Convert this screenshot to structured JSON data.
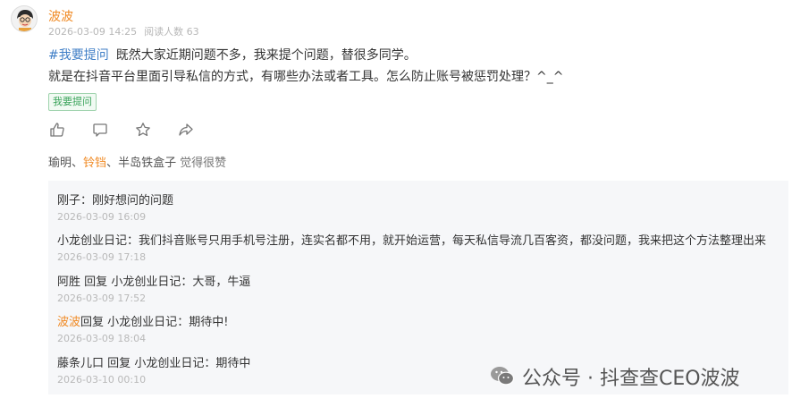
{
  "post": {
    "author": "波波",
    "date": "2026-03-09 14:25",
    "reads": "阅读人数 63",
    "hashtag": "#我要提问",
    "line1": "既然大家近期问题不多，我来提个问题，替很多同学。",
    "line2": "就是在抖音平台里面引导私信的方式，有哪些办法或者工具。怎么防止账号被惩罚处理？^_^",
    "tag": "我要提问"
  },
  "likes": {
    "names": [
      "瑜明",
      "铃铛",
      "半岛铁盒子"
    ],
    "suffix": "觉得很赞"
  },
  "comments": [
    {
      "author": "刚子",
      "text": "刚好想问的问题",
      "time": "2026-03-09 16:09"
    },
    {
      "author": "小龙创业日记",
      "text": "我们抖音账号只用手机号注册，连实名都不用，就开始运营，每天私信导流几百客资，都没问题，我来把这个方法整理出来",
      "time": "2026-03-09 17:18"
    },
    {
      "author": "阿胜",
      "reply_word": "回复",
      "reply_to": "小龙创业日记",
      "text": "大哥，牛逼",
      "time": "2026-03-09 17:52"
    },
    {
      "author": "波波",
      "reply_word": "回复",
      "reply_to": "小龙创业日记",
      "text": "期待中!",
      "time": "2026-03-09 18:04"
    },
    {
      "author": "藤条儿口",
      "reply_word": "回复",
      "reply_to": "小龙创业日记",
      "text": "期待中",
      "time": "2026-03-10 00:10"
    }
  ],
  "watermark": {
    "text": "公众号 · 抖查查CEO波波"
  },
  "colors": {
    "accent": "#f08a24",
    "link": "#3f7ec6",
    "tag_green": "#39a35a",
    "panel_bg": "#f6f7f9"
  },
  "icons": [
    "avatar",
    "thumb-up-icon",
    "comment-icon",
    "star-icon",
    "share-icon",
    "wechat-logo-icon"
  ]
}
